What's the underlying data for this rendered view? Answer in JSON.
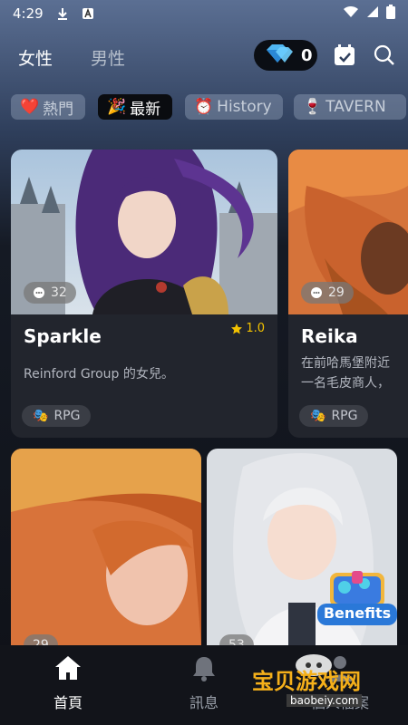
{
  "status": {
    "time": "4:29"
  },
  "header": {
    "tabs": [
      {
        "label": "女性"
      },
      {
        "label": "男性"
      }
    ],
    "diamonds": "0",
    "icons": [
      "diamond-icon",
      "calendar-check-icon",
      "search-icon"
    ]
  },
  "filters": [
    {
      "label": "熱門",
      "icon": "heart-icon",
      "emoji": "❤️"
    },
    {
      "label": "最新",
      "icon": "party-popper-icon",
      "emoji": "🎉"
    },
    {
      "label": "History",
      "icon": "alarm-clock-icon",
      "emoji": "⏰"
    },
    {
      "label": "TAVERN",
      "icon": "wine-glass-icon",
      "emoji": "🍷"
    }
  ],
  "cards": [
    {
      "name": "Sparkle",
      "rating": "1.0",
      "comments": "32",
      "desc": "Reinford Group 的女兒。",
      "tag": "RPG"
    },
    {
      "name": "Reika",
      "comments": "29",
      "desc1": "在前哈馬堡附近",
      "desc2": "一名毛皮商人，",
      "tag": "RPG"
    },
    {
      "comments": "29"
    },
    {
      "comments": "53"
    }
  ],
  "overlays": {
    "benefits": "Benefits",
    "watermark_cn": "宝贝游戏网",
    "watermark_url": "baobeiy.com"
  },
  "nav": [
    {
      "label": "首頁",
      "icon": "home-icon"
    },
    {
      "label": "訊息",
      "icon": "bell-icon"
    },
    {
      "label": "個人檔案",
      "icon": "person-icon"
    }
  ],
  "colors": {
    "accent_rating": "#f3c200",
    "chip_active": "#0a0c10",
    "benefits_text": "#ffffff"
  }
}
